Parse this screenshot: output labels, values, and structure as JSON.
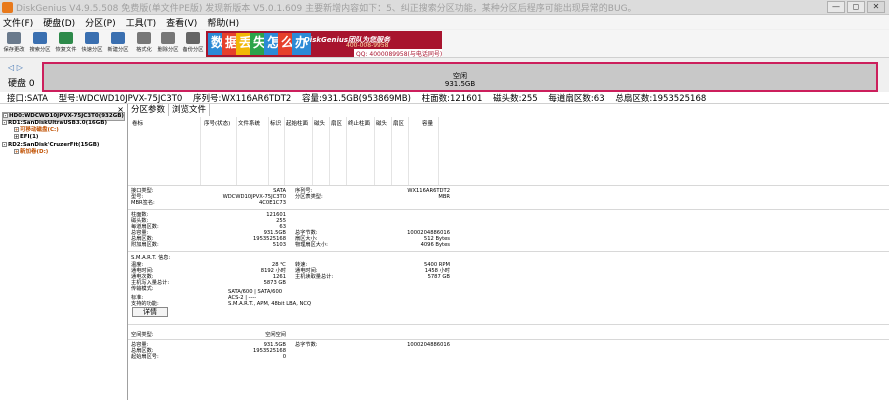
{
  "window": {
    "title": "DiskGenius V4.9.5.508 免费版(单文件PE版)   发现新版本 V5.0.1.609 主要新增内容如下：5、纠正搜索分区功能，某种分区后程序可能出现异常的BUG。",
    "buttons": [
      "—",
      "◻",
      "✕"
    ]
  },
  "menu": [
    "文件(F)",
    "硬盘(D)",
    "分区(P)",
    "工具(T)",
    "查看(V)",
    "帮助(H)"
  ],
  "toolbar": [
    {
      "label": "保存更改",
      "icon": "save-icon",
      "color": "#6a7a8c"
    },
    {
      "label": "搜索分区",
      "icon": "search-icon",
      "color": "#3a6fb0"
    },
    {
      "label": "恢复文件",
      "icon": "recover-icon",
      "color": "#2d8a4a"
    },
    {
      "label": "快速分区",
      "icon": "quick-partition-icon",
      "color": "#3a6fb0"
    },
    {
      "label": "新建分区",
      "icon": "new-partition-icon",
      "color": "#3a6fb0"
    },
    {
      "label": "格式化",
      "icon": "format-icon",
      "color": "#777777"
    },
    {
      "label": "删除分区",
      "icon": "delete-partition-icon",
      "color": "#777777"
    },
    {
      "label": "备份分区",
      "icon": "backup-icon",
      "color": "#666666"
    }
  ],
  "banner": {
    "tiles": [
      "数",
      "据",
      "丢",
      "失",
      "怎",
      "么",
      "办"
    ],
    "tile_colors": [
      "#2b8ad6",
      "#e6402b",
      "#f2b705",
      "#2ca34a",
      "#2b8ad6",
      "#e6402b",
      "#2b8ad6"
    ],
    "promo": "DiskGenius团队为您服务",
    "phone": "400-008-9958",
    "qq": "QQ: 4000089958(与电话同号)"
  },
  "disk": {
    "nav": "◁ ▷",
    "label": "硬盘 0",
    "map_line1": "空闲",
    "map_line2": "931.5GB"
  },
  "infoline": [
    "接口:SATA",
    "型号:WDCWD10JPVX-75JC3T0",
    "序列号:WX116AR6TDT2",
    "容量:931.5GB(953869MB)",
    "柱面数:121601",
    "磁头数:255",
    "每道扇区数:63",
    "总扇区数:1953525168"
  ],
  "tree": {
    "close": "×",
    "items": [
      {
        "text": "HD0:WDCWD10JPVX-75JC3T0(932GB)",
        "color": "#000000",
        "sel": true
      },
      {
        "text": "RD1:SanDiskUltraUSB3.0(16GB)",
        "color": "#000000",
        "sel": false
      },
      {
        "text": "可移动磁盘(C:)",
        "color": "#c05000",
        "sel": false
      },
      {
        "text": "EFI(1)",
        "color": "#000000",
        "sel": false
      },
      {
        "text": "RD2:SanDisk'CruzerFit(15GB)",
        "color": "#000000",
        "sel": false
      },
      {
        "text": "新加卷(D:)",
        "color": "#c05000",
        "sel": false
      }
    ]
  },
  "tabs": [
    "分区参数",
    "浏览文件"
  ],
  "partition_table": {
    "headers": [
      "卷标",
      "序号(状态)",
      "文件系统",
      "标识",
      "起始柱面",
      "磁头",
      "扇区",
      "终止柱面",
      "磁头",
      "扇区",
      "容量"
    ]
  },
  "details": {
    "left_1": [
      [
        "接口类型:",
        "SATA"
      ],
      [
        "型号:",
        "WDCWD10JPVX-75JC3T0"
      ],
      [
        "MBR签名:",
        "4C0E1C73"
      ]
    ],
    "right_1": [
      [
        "序列号:",
        "WX116AR6TDT2"
      ],
      [
        "分区表类型:",
        "MBR"
      ]
    ],
    "left_2": [
      [
        "柱面数:",
        "121601"
      ],
      [
        "磁头数:",
        "255"
      ],
      [
        "每道扇区数:",
        "63"
      ],
      [
        "总容量:",
        "931.5GB"
      ],
      [
        "总扇区数:",
        "1953525168"
      ],
      [
        "附加扇区数:",
        "5103"
      ]
    ],
    "right_2": [
      [
        "总字节数:",
        "1000204886016"
      ],
      [
        "扇区大小:",
        "512 Bytes"
      ],
      [
        "物理扇区大小:",
        "4096 Bytes"
      ]
    ],
    "smart_title": "S.M.A.R.T. 信息:",
    "left_3": [
      [
        "温度:",
        "28 ℃"
      ],
      [
        "通电时间:",
        "8192 小时"
      ],
      [
        "通电次数:",
        "1261"
      ],
      [
        "主机写入量总计:",
        "5873 GB"
      ],
      [
        "传输模式:",
        "SATA/600 | SATA/600"
      ],
      [
        "标准:",
        "ACS-2 | ----"
      ],
      [
        "支持的功能:",
        "S.M.A.R.T., APM, 48bit LBA, NCQ"
      ]
    ],
    "right_3": [
      [
        "转速:",
        "5400 RPM"
      ],
      [
        "通电时间:",
        "1458 小时"
      ],
      [
        "主机读取量总计:",
        "5787 GB"
      ]
    ],
    "detail_button": "详情",
    "left_4": [
      [
        "空间类型:",
        "空闲空间"
      ]
    ],
    "left_5": [
      [
        "总容量:",
        "931.5GB"
      ],
      [
        "总扇区数:",
        "1953525168"
      ],
      [
        "起始扇区号:",
        "0"
      ]
    ],
    "right_5": [
      [
        "总字节数:",
        "1000204886016"
      ]
    ]
  }
}
